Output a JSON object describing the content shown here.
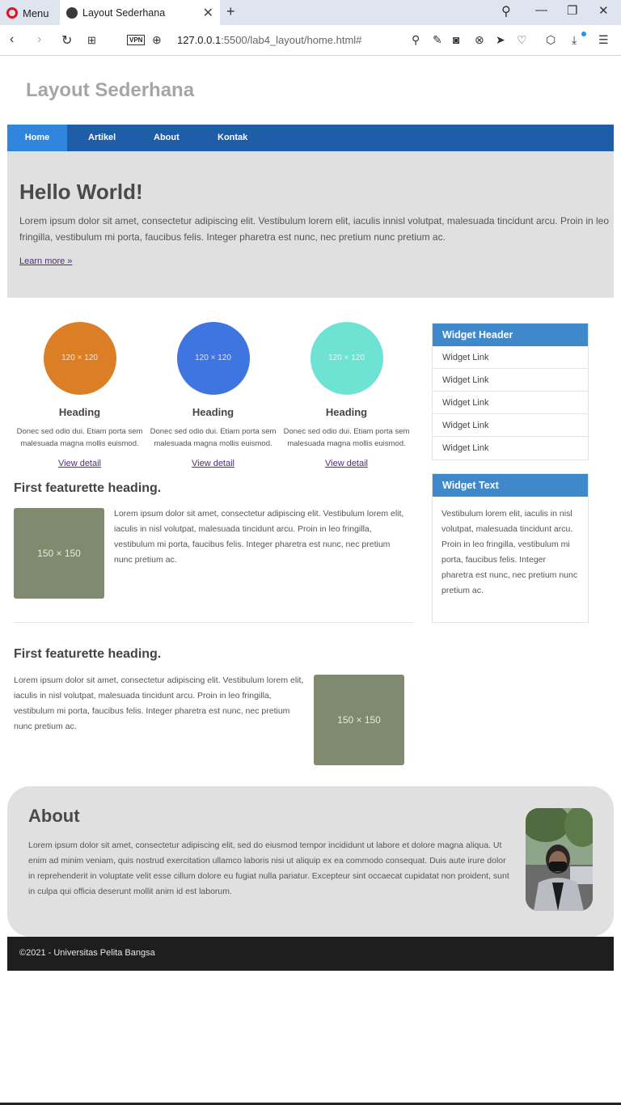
{
  "browser": {
    "menu_label": "Menu",
    "tab_title": "Layout Sederhana",
    "vpn_label": "VPN",
    "url_host": "127.0.0.1",
    "url_path": ":5500/lab4_layout/home.html#"
  },
  "site": {
    "title": "Layout Sederhana",
    "nav": [
      "Home",
      "Artikel",
      "About",
      "Kontak"
    ]
  },
  "hero": {
    "title": "Hello World!",
    "text": "Lorem ipsum dolor sit amet, consectetur adipiscing elit. Vestibulum lorem elit, iaculis innisl volutpat, malesuada tincidunt arcu. Proin in leo fringilla, vestibulum mi porta, faucibus felis. Integer pharetra est nunc, nec pretium nunc pretium ac.",
    "link": "Learn more »"
  },
  "cards": [
    {
      "placeholder": "120 × 120",
      "heading": "Heading",
      "text": "Donec sed odio dui. Etiam porta sem malesuada magna mollis euismod.",
      "link": "View detail",
      "color": "#dc7e25"
    },
    {
      "placeholder": "120 × 120",
      "heading": "Heading",
      "text": "Donec sed odio dui. Etiam porta sem malesuada magna mollis euismod.",
      "link": "View detail",
      "color": "#3f75e0"
    },
    {
      "placeholder": "120 × 120",
      "heading": "Heading",
      "text": "Donec sed odio dui. Etiam porta sem malesuada magna mollis euismod.",
      "link": "View detail",
      "color": "#6fe3d3"
    }
  ],
  "featurettes": [
    {
      "heading": "First featurette heading.",
      "placeholder": "150 × 150",
      "text": "Lorem ipsum dolor sit amet, consectetur adipiscing elit. Vestibulum lorem elit, iaculis in nisl volutpat, malesuada tincidunt arcu. Proin in leo fringilla, vestibulum mi porta, faucibus felis. Integer pharetra est nunc, nec pretium nunc pretium ac."
    },
    {
      "heading": "First featurette heading.",
      "placeholder": "150 × 150",
      "text": "Lorem ipsum dolor sit amet, consectetur adipiscing elit. Vestibulum lorem elit, iaculis in nisl volutpat, malesuada tincidunt arcu. Proin in leo fringilla, vestibulum mi porta, faucibus felis. Integer pharetra est nunc, nec pretium nunc pretium ac."
    }
  ],
  "widgets": {
    "links_header": "Widget Header",
    "links": [
      "Widget Link",
      "Widget Link",
      "Widget Link",
      "Widget Link",
      "Widget Link"
    ],
    "text_header": "Widget Text",
    "text": "Vestibulum lorem elit, iaculis in nisl volutpat, malesuada tincidunt arcu. Proin in leo fringilla, vestibulum mi porta, faucibus felis. Integer pharetra est nunc, nec pretium nunc pretium ac."
  },
  "about": {
    "title": "About",
    "text": "Lorem ipsum dolor sit amet, consectetur adipiscing elit, sed do eiusmod tempor incididunt ut labore et dolore magna aliqua. Ut enim ad minim veniam, quis nostrud exercitation ullamco laboris nisi ut aliquip ex ea commodo consequat. Duis aute irure dolor in reprehenderit in voluptate velit esse cillum dolore eu fugiat nulla pariatur. Excepteur sint occaecat cupidatat non proident, sunt in culpa qui officia deserunt mollit anim id est laborum."
  },
  "footer": {
    "text": "©2021 - Universitas Pelita Bangsa"
  }
}
